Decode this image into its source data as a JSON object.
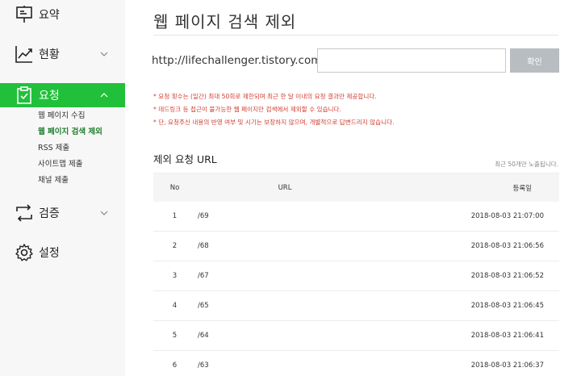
{
  "sidebar": {
    "items": [
      {
        "label": "요약",
        "icon": "presentation-board-icon",
        "has_chevron": false
      },
      {
        "label": "현황",
        "icon": "line-chart-icon",
        "has_chevron": true
      },
      {
        "label": "요청",
        "icon": "clipboard-check-icon",
        "has_chevron": true,
        "active": true
      },
      {
        "label": "검증",
        "icon": "sync-arrows-icon",
        "has_chevron": true
      },
      {
        "label": "설정",
        "icon": "gear-icon",
        "has_chevron": false
      }
    ],
    "sub_items": [
      {
        "label": "웹 페이지 수집"
      },
      {
        "label": "웹 페이지 검색 제외",
        "current": true
      },
      {
        "label": "RSS 제출"
      },
      {
        "label": "사이트맵 제출"
      },
      {
        "label": "채널 제출"
      }
    ]
  },
  "main": {
    "title": "웹 페이지 검색 제외",
    "url_prefix": "http://lifechallenger.tistory.com/",
    "input": {
      "value": "",
      "placeholder": ""
    },
    "confirm_label": "확인",
    "notices": [
      "* 요청 횟수는 (일간) 최대 50회로 제한되며 최근 한 달 이내의 요청 결과만 제공합니다.",
      "* 데드링크 등 접근이 불가능한 웹 페이지만 검색에서 제외할 수 있습니다.",
      "* 단, 요청주신 내용의 반영 여부 및 시기는 보장하지 않으며, 개별적으로 답변드리지 않습니다."
    ],
    "section_title": "제외 요청 URL",
    "section_note": "최근 50개만 노출됩니다.",
    "table": {
      "headers": {
        "no": "No",
        "url": "URL",
        "date": "등록일"
      },
      "rows": [
        {
          "no": "1",
          "url": "/69",
          "date": "2018-08-03 21:07:00"
        },
        {
          "no": "2",
          "url": "/68",
          "date": "2018-08-03 21:06:56"
        },
        {
          "no": "3",
          "url": "/67",
          "date": "2018-08-03 21:06:52"
        },
        {
          "no": "4",
          "url": "/65",
          "date": "2018-08-03 21:06:45"
        },
        {
          "no": "5",
          "url": "/64",
          "date": "2018-08-03 21:06:41"
        },
        {
          "no": "6",
          "url": "/63",
          "date": "2018-08-03 21:06:37"
        }
      ]
    }
  },
  "colors": {
    "accent": "#21c03b",
    "active_sub": "#1e7d2e",
    "notice": "#d33b2f",
    "button": "#b8bdc2"
  }
}
